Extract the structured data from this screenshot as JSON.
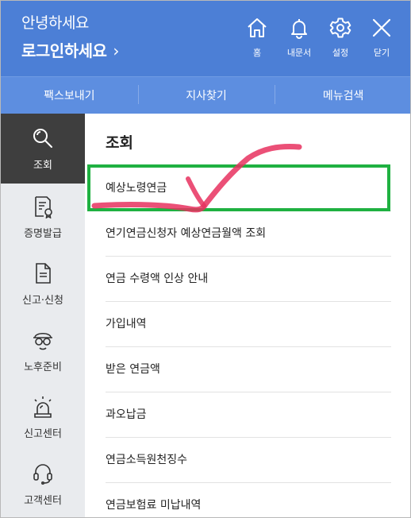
{
  "header": {
    "greeting": "안녕하세요",
    "login_label": "로그인하세요",
    "login_chevron": "›",
    "icons": [
      {
        "name": "home-icon",
        "label": "홈"
      },
      {
        "name": "bell-icon",
        "label": "내문서"
      },
      {
        "name": "gear-icon",
        "label": "설정"
      },
      {
        "name": "close-icon",
        "label": "닫기"
      }
    ]
  },
  "subnav": {
    "items": [
      "팩스보내기",
      "지사찾기",
      "메뉴검색"
    ]
  },
  "sidebar": {
    "items": [
      {
        "label": "조회",
        "icon": "search-icon",
        "active": true
      },
      {
        "label": "증명발급",
        "icon": "certificate-icon",
        "active": false
      },
      {
        "label": "신고·신청",
        "icon": "document-icon",
        "active": false
      },
      {
        "label": "노후준비",
        "icon": "person-glasses-icon",
        "active": false
      },
      {
        "label": "신고센터",
        "icon": "alarm-light-icon",
        "active": false
      },
      {
        "label": "고객센터",
        "icon": "headset-icon",
        "active": false
      }
    ]
  },
  "main": {
    "title": "조회",
    "items": [
      "예상노령연금",
      "연기연금신청자 예상연금월액 조회",
      "연금 수령액 인상 안내",
      "가입내역",
      "받은 연금액",
      "과오납금",
      "연금소득원천징수",
      "연금보험료 미납내역"
    ]
  },
  "colors": {
    "header_bg": "#4c7fd6",
    "subnav_bg": "#5d8ee0",
    "sidebar_bg": "#e9ebee",
    "sidebar_active_bg": "#3e3e3e",
    "highlight_box": "#1fb141",
    "check_mark": "#e8315f"
  }
}
